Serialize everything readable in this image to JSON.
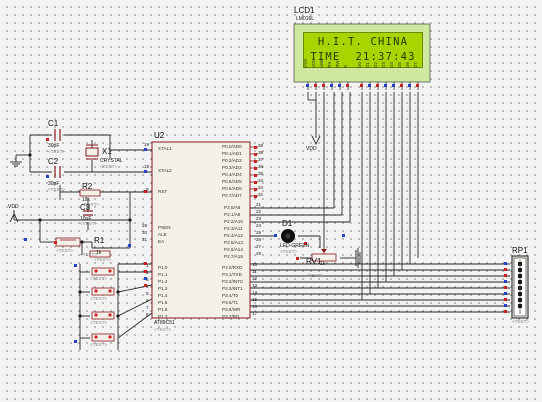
{
  "lcd": {
    "ref": "LCD1",
    "model": "LM016L",
    "line1": "H.I.T. CHINA",
    "line2": "TIME  21:37:43",
    "pins": [
      "VSS",
      "VDD",
      "VEE",
      "RS",
      "RW",
      "E",
      "D0",
      "D1",
      "D2",
      "D3",
      "D4",
      "D5",
      "D6",
      "D7"
    ]
  },
  "mcu": {
    "ref": "U2",
    "model": "AT89C51",
    "text_placeholder": "<TEXT>",
    "left_pins": [
      {
        "num": "19",
        "name": "XTAL1"
      },
      {
        "num": "18",
        "name": "XTAL2"
      },
      {
        "num": "9",
        "name": "RST"
      },
      {
        "num": "29",
        "name": "PSEN"
      },
      {
        "num": "30",
        "name": "ALE"
      },
      {
        "num": "31",
        "name": "EA"
      },
      {
        "num": "1",
        "name": "P1.0"
      },
      {
        "num": "2",
        "name": "P1.1"
      },
      {
        "num": "3",
        "name": "P1.2"
      },
      {
        "num": "4",
        "name": "P1.3"
      },
      {
        "num": "5",
        "name": "P1.4"
      },
      {
        "num": "6",
        "name": "P1.5"
      },
      {
        "num": "7",
        "name": "P1.6"
      },
      {
        "num": "8",
        "name": "P1.7"
      }
    ],
    "right_pins": [
      {
        "num": "39",
        "name": "P0.0/AD0"
      },
      {
        "num": "38",
        "name": "P0.1/AD1"
      },
      {
        "num": "37",
        "name": "P0.2/AD2"
      },
      {
        "num": "36",
        "name": "P0.3/AD3"
      },
      {
        "num": "35",
        "name": "P0.4/AD4"
      },
      {
        "num": "34",
        "name": "P0.5/AD5"
      },
      {
        "num": "33",
        "name": "P0.6/AD6"
      },
      {
        "num": "32",
        "name": "P0.7/AD7"
      },
      {
        "num": "21",
        "name": "P2.0/A8"
      },
      {
        "num": "22",
        "name": "P2.1/A9"
      },
      {
        "num": "23",
        "name": "P2.2/A10"
      },
      {
        "num": "24",
        "name": "P2.3/A11"
      },
      {
        "num": "25",
        "name": "P2.4/A12"
      },
      {
        "num": "26",
        "name": "P2.5/A13"
      },
      {
        "num": "27",
        "name": "P2.6/A14"
      },
      {
        "num": "28",
        "name": "P2.7/A15"
      },
      {
        "num": "10",
        "name": "P3.0/RXD"
      },
      {
        "num": "11",
        "name": "P3.1/TXD"
      },
      {
        "num": "12",
        "name": "P3.2/INT0"
      },
      {
        "num": "13",
        "name": "P3.3/INT1"
      },
      {
        "num": "14",
        "name": "P3.4/T0"
      },
      {
        "num": "15",
        "name": "P3.5/T1"
      },
      {
        "num": "16",
        "name": "P3.6/WR"
      },
      {
        "num": "17",
        "name": "P3.7/RD"
      }
    ]
  },
  "components": {
    "c1": {
      "ref": "C1",
      "value": "30pF"
    },
    "c2": {
      "ref": "C2",
      "value": "30pF"
    },
    "c3": {
      "ref": "C3",
      "value": "10uF"
    },
    "x1": {
      "ref": "X1",
      "value": "CRYSTAL"
    },
    "r1": {
      "ref": "R1",
      "value": "1k"
    },
    "r2": {
      "ref": "R2",
      "value": "10k"
    },
    "d1": {
      "ref": "D1",
      "value": "LED-GREEN"
    },
    "rv1": {
      "ref": "RV1",
      "value": "1k"
    },
    "rp1": {
      "ref": "RP1",
      "value": ""
    },
    "vdd_left": "VDD",
    "vdd_mid": "VDD",
    "text_placeholder": "<TEXT>"
  },
  "colors": {
    "wire": "#2a2a2a",
    "component_outline": "#8b1a1a",
    "chip_fill": "#f4f0e8",
    "lcd_frame": "#cfe8a0",
    "lcd_screen": "#a8d400",
    "pin_blue": "#2244cc",
    "pin_red": "#cc2222",
    "led_color": "#111111"
  }
}
